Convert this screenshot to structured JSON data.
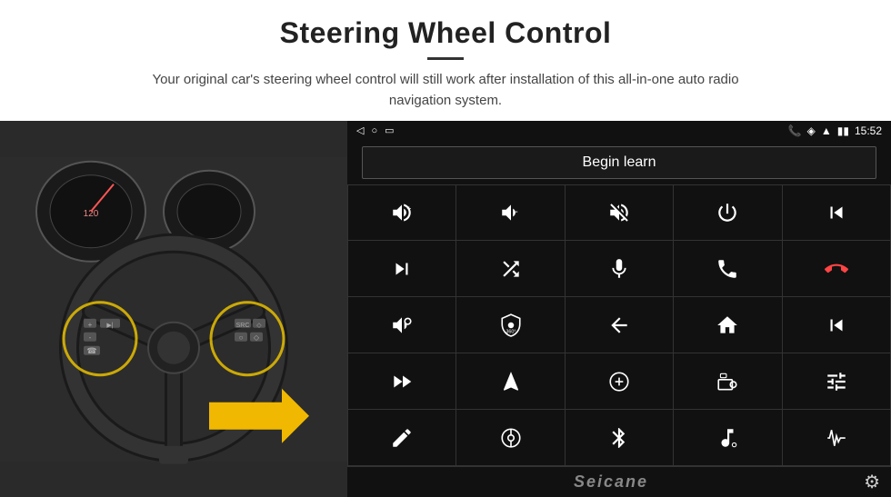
{
  "header": {
    "title": "Steering Wheel Control",
    "subtitle": "Your original car's steering wheel control will still work after installation of this all-in-one auto radio navigation system."
  },
  "statusbar": {
    "nav_back": "◁",
    "nav_home": "○",
    "nav_recent": "□",
    "signal": "▮▮",
    "phone_icon": "📞",
    "location_icon": "◈",
    "wifi_icon": "▲",
    "time": "15:52"
  },
  "begin_learn": {
    "label": "Begin learn"
  },
  "icon_grid": [
    {
      "id": "vol_up",
      "symbol": "vol_up"
    },
    {
      "id": "vol_down",
      "symbol": "vol_down"
    },
    {
      "id": "vol_mute",
      "symbol": "vol_mute"
    },
    {
      "id": "power",
      "symbol": "power"
    },
    {
      "id": "phone_prev",
      "symbol": "phone_prev"
    },
    {
      "id": "skip_next",
      "symbol": "skip_next"
    },
    {
      "id": "shuffle",
      "symbol": "shuffle"
    },
    {
      "id": "mic",
      "symbol": "mic"
    },
    {
      "id": "phone",
      "symbol": "phone"
    },
    {
      "id": "hang_up",
      "symbol": "hang_up"
    },
    {
      "id": "horn",
      "symbol": "horn"
    },
    {
      "id": "camera360",
      "symbol": "camera360"
    },
    {
      "id": "back",
      "symbol": "back"
    },
    {
      "id": "home",
      "symbol": "home"
    },
    {
      "id": "skip_prev2",
      "symbol": "skip_prev2"
    },
    {
      "id": "fast_forward",
      "symbol": "fast_forward"
    },
    {
      "id": "navigation",
      "symbol": "navigation"
    },
    {
      "id": "equalizer",
      "symbol": "equalizer"
    },
    {
      "id": "radio",
      "symbol": "radio"
    },
    {
      "id": "settings_sliders",
      "symbol": "settings_sliders"
    },
    {
      "id": "edit",
      "symbol": "edit"
    },
    {
      "id": "steering_assist",
      "symbol": "steering_assist"
    },
    {
      "id": "bluetooth",
      "symbol": "bluetooth"
    },
    {
      "id": "music_settings",
      "symbol": "music_settings"
    },
    {
      "id": "waveform",
      "symbol": "waveform"
    }
  ],
  "bottom": {
    "brand": "Seicane"
  }
}
